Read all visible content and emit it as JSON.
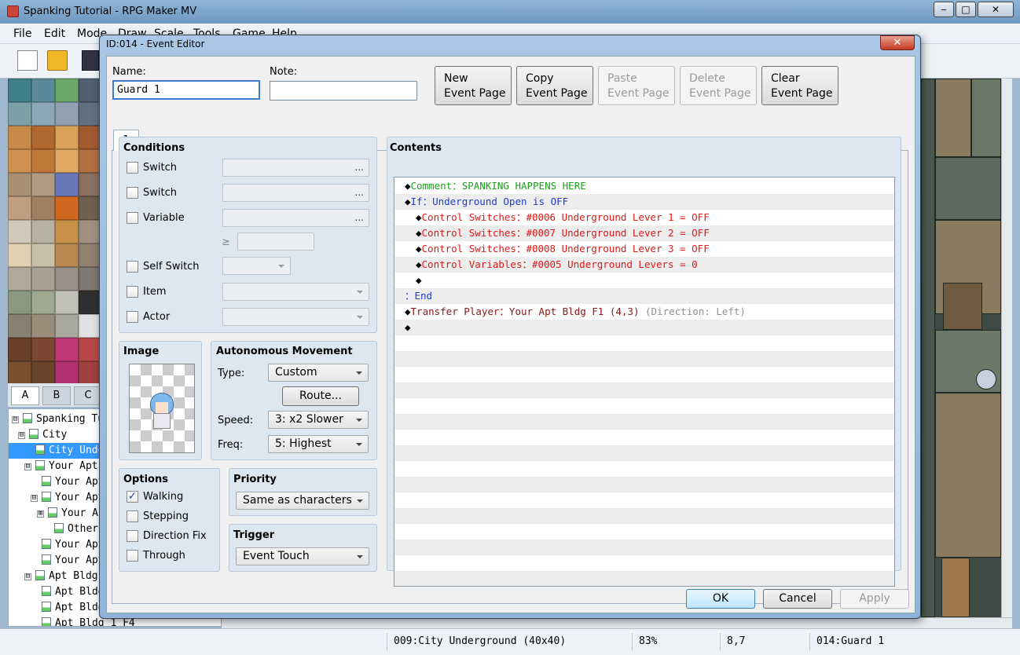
{
  "app": {
    "title": "Spanking Tutorial - RPG Maker MV",
    "window_buttons": [
      "‒",
      "□",
      "✕"
    ],
    "menus": [
      "File",
      "Edit",
      "Mode",
      "Draw",
      "Scale",
      "Tools",
      "Game",
      "Help"
    ],
    "tileset_tabs": [
      "A",
      "B",
      "C"
    ],
    "map_tree": [
      {
        "label": "Spanking Tutorial",
        "level": 0,
        "expander": "⊟"
      },
      {
        "label": "City",
        "level": 1,
        "expander": "⊟"
      },
      {
        "label": "City Underground",
        "level": 2,
        "expander": "",
        "selected": true
      },
      {
        "label": "Your Apt Bldg",
        "level": 2,
        "expander": "⊟"
      },
      {
        "label": "Your Apt",
        "level": 3,
        "expander": ""
      },
      {
        "label": "Your Apt",
        "level": 3,
        "expander": "⊟"
      },
      {
        "label": "Your Apt",
        "level": 4,
        "expander": "⊞"
      },
      {
        "label": "Other Apt",
        "level": 5,
        "expander": ""
      },
      {
        "label": "Your Apt",
        "level": 3,
        "expander": ""
      },
      {
        "label": "Your Apt",
        "level": 3,
        "expander": ""
      },
      {
        "label": "Apt Bldg",
        "level": 2,
        "expander": "⊟"
      },
      {
        "label": "Apt Bldg",
        "level": 3,
        "expander": ""
      },
      {
        "label": "Apt Bldg",
        "level": 3,
        "expander": ""
      },
      {
        "label": "Apt Bldg 1 F4",
        "level": 3,
        "expander": ""
      }
    ],
    "status": {
      "map": "009:City Underground (40x40)",
      "zoom": "83%",
      "coords": "8,7",
      "event": "014:Guard 1"
    }
  },
  "dialog": {
    "title": "ID:014 - Event Editor",
    "close_label": "✕",
    "name_label": "Name:",
    "name_value": "Guard 1",
    "note_label": "Note:",
    "note_value": "",
    "page_buttons": [
      {
        "line1": "New",
        "line2": "Event Page",
        "enabled": true
      },
      {
        "line1": "Copy",
        "line2": "Event Page",
        "enabled": true
      },
      {
        "line1": "Paste",
        "line2": "Event Page",
        "enabled": false
      },
      {
        "line1": "Delete",
        "line2": "Event Page",
        "enabled": false
      },
      {
        "line1": "Clear",
        "line2": "Event Page",
        "enabled": true
      }
    ],
    "tab_label": "1",
    "conditions": {
      "title": "Conditions",
      "switch1": "Switch",
      "switch2": "Switch",
      "variable": "Variable",
      "ge_symbol": "≥",
      "self_switch": "Self Switch",
      "item": "Item",
      "actor": "Actor",
      "dots": "..."
    },
    "image_title": "Image",
    "autonomous": {
      "title": "Autonomous Movement",
      "type_label": "Type:",
      "type_value": "Custom",
      "route_button": "Route...",
      "speed_label": "Speed:",
      "speed_value": "3: x2 Slower",
      "freq_label": "Freq:",
      "freq_value": "5: Highest"
    },
    "options": {
      "title": "Options",
      "walking": "Walking",
      "walking_checked": true,
      "stepping": "Stepping",
      "direction_fix": "Direction Fix",
      "through": "Through",
      "check_mark": "✓"
    },
    "priority": {
      "title": "Priority",
      "value": "Same as characters"
    },
    "trigger": {
      "title": "Trigger",
      "value": "Event Touch"
    },
    "contents": {
      "title": "Contents",
      "rows": [
        {
          "indent": 0,
          "bullet": "◆",
          "parts": [
            {
              "text": "Comment：SPANKING HAPPENS HERE",
              "color": "green"
            }
          ]
        },
        {
          "indent": 0,
          "bullet": "◆",
          "parts": [
            {
              "text": "If：Underground Open is OFF",
              "color": "blue"
            }
          ]
        },
        {
          "indent": 1,
          "bullet": "◆",
          "parts": [
            {
              "text": "Control Switches：#0006 Underground Lever 1 = OFF",
              "color": "red"
            }
          ]
        },
        {
          "indent": 1,
          "bullet": "◆",
          "parts": [
            {
              "text": "Control Switches：#0007 Underground Lever 2 = OFF",
              "color": "red"
            }
          ]
        },
        {
          "indent": 1,
          "bullet": "◆",
          "parts": [
            {
              "text": "Control Switches：#0008 Underground Lever 3 = OFF",
              "color": "red"
            }
          ]
        },
        {
          "indent": 1,
          "bullet": "◆",
          "parts": [
            {
              "text": "Control Variables：#0005 Underground Levers = 0",
              "color": "red"
            }
          ]
        },
        {
          "indent": 1,
          "bullet": "◆",
          "parts": []
        },
        {
          "indent": 0,
          "bullet": "",
          "parts": [
            {
              "text": "：End",
              "color": "blue"
            }
          ]
        },
        {
          "indent": 0,
          "bullet": "◆",
          "parts": [
            {
              "text": "Transfer Player：Your Apt Bldg F1 (4,3)",
              "color": "brown"
            },
            {
              "text": " (Direction: Left)",
              "color": "gray"
            }
          ]
        },
        {
          "indent": 0,
          "bullet": "◆",
          "parts": []
        }
      ]
    },
    "ok": "OK",
    "cancel": "Cancel",
    "apply": "Apply"
  },
  "colors": {
    "green": "#18a018",
    "blue": "#1e3cd2",
    "red": "#e01818",
    "brown": "#8a1616",
    "gray": "#909090"
  }
}
